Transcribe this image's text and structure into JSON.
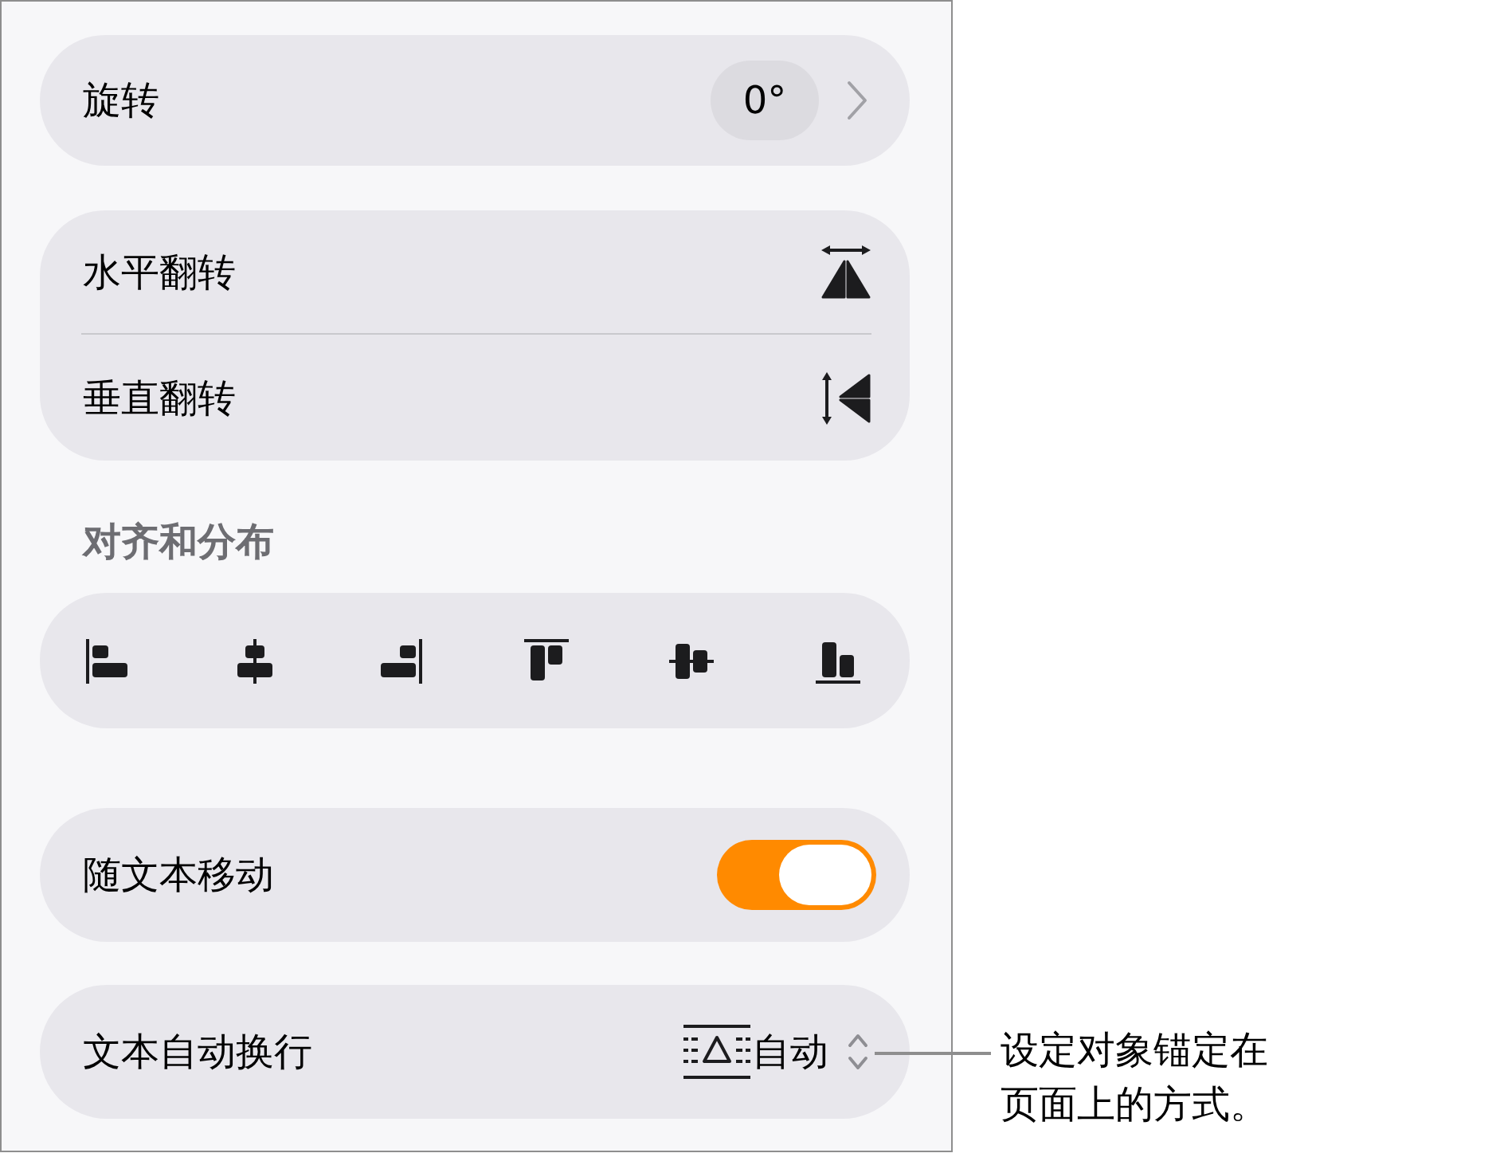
{
  "rotation": {
    "label": "旋转",
    "value": "0°"
  },
  "flip": [
    {
      "label": "水平翻转",
      "kind": "horizontal"
    },
    {
      "label": "垂直翻转",
      "kind": "vertical"
    }
  ],
  "align_section": {
    "title": "对齐和分布",
    "buttons": [
      {
        "kind": "left"
      },
      {
        "kind": "center"
      },
      {
        "kind": "right"
      },
      {
        "kind": "top"
      },
      {
        "kind": "middle"
      },
      {
        "kind": "bottom"
      }
    ]
  },
  "move_with_text": {
    "label": "随文本移动",
    "on": true
  },
  "text_wrap": {
    "label": "文本自动换行",
    "value": "自动"
  },
  "callout": "设定对象锚定在页面上的方式。"
}
